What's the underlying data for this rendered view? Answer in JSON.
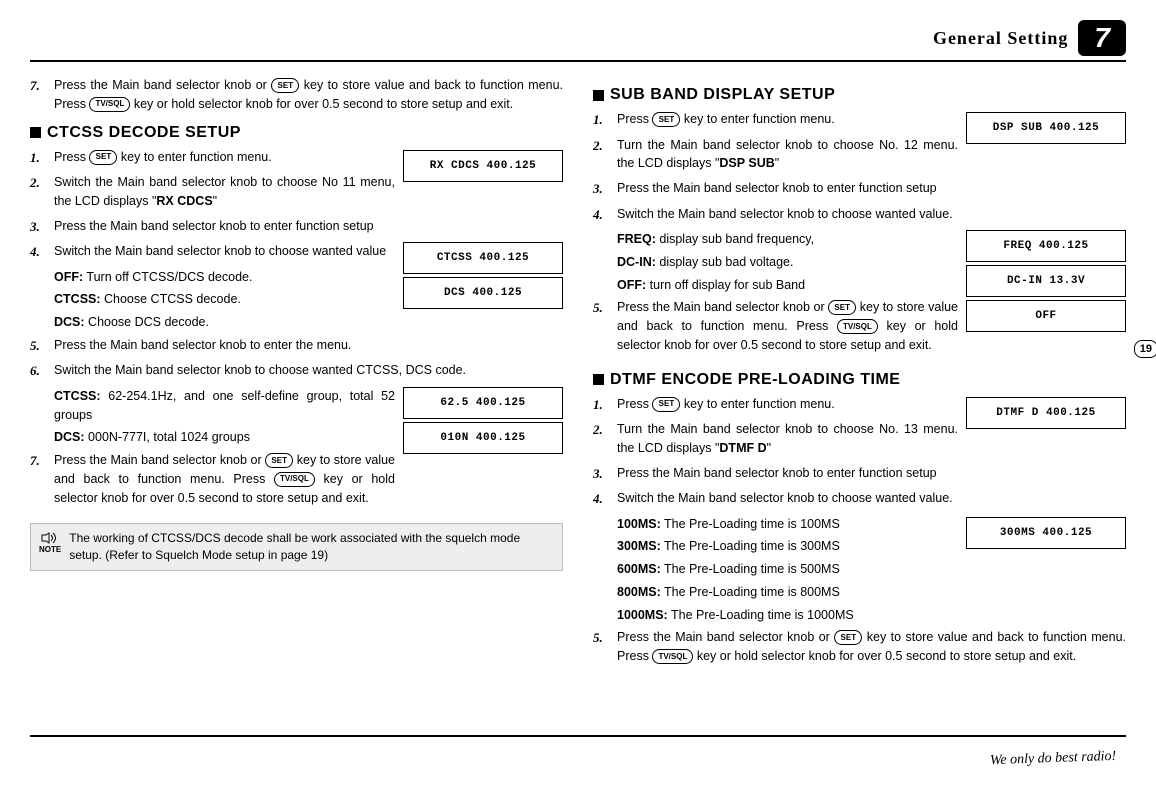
{
  "header": {
    "title": "General Setting",
    "chapter": "7"
  },
  "page_number": "19",
  "footer": "We only do best radio!",
  "keys": {
    "set": "SET",
    "tvsql": "TV/SQL"
  },
  "left": {
    "top_step": {
      "num": "7.",
      "text_a": "Press the Main band selector knob or ",
      "text_b": " key to store value and back to function menu.  Press ",
      "text_c": " key or hold selector knob for over 0.5 second to store setup and exit."
    },
    "ctcss": {
      "heading": "CTCSS DECODE SETUP",
      "lcd1": "RX CDCS 400.125",
      "lcd2": "CTCSS 400.125",
      "lcd3": "DCS 400.125",
      "lcd4": "62.5 400.125",
      "lcd5": "010N 400.125",
      "steps": {
        "s1_num": "1.",
        "s1_a": "Press ",
        "s1_b": " key to enter function menu.",
        "s2_num": "2.",
        "s2": "Switch the Main band selector knob to choose No 11 menu, the LCD displays \"",
        "s2_bold": "RX CDCS",
        "s2_c": "\"",
        "s3_num": "3.",
        "s3": "Press the Main band selector knob to enter function setup",
        "s4_num": "4.",
        "s4": "Switch the Main band selector knob to choose wanted value",
        "s4_sub1_b": "OFF:",
        "s4_sub1": " Turn off CTCSS/DCS decode.",
        "s4_sub2_b": "CTCSS:",
        "s4_sub2": " Choose CTCSS decode.",
        "s4_sub3_b": "DCS:",
        "s4_sub3": " Choose DCS decode.",
        "s5_num": "5.",
        "s5": "Press the Main band selector knob to enter the menu.",
        "s6_num": "6.",
        "s6": "Switch the Main band selector knob to choose wanted CTCSS, DCS code.",
        "s6_sub1_b": "CTCSS:",
        "s6_sub1": " 62-254.1Hz, and one self-define group, total 52 groups",
        "s6_sub2_b": "DCS:",
        "s6_sub2": " 000N-777I, total 1024 groups",
        "s7_num": "7.",
        "s7_a": "Press the Main band selector knob or ",
        "s7_b": "key to store value and back to function menu.  Press ",
        "s7_c": " key or hold selector knob for over 0.5 second to store setup and exit."
      },
      "note_label": "NOTE",
      "note": "The working of CTCSS/DCS decode shall be work associated with the squelch mode setup. (Refer to Squelch Mode setup in page 19)"
    }
  },
  "right": {
    "sub_band": {
      "heading": "SUB BAND DISPLAY SETUP",
      "lcd1": "DSP SUB 400.125",
      "lcd2": "FREQ 400.125",
      "lcd3": "DC-IN 13.3V",
      "lcd4": "OFF",
      "s1_num": "1.",
      "s1_a": "Press ",
      "s1_b": " key to enter function menu.",
      "s2_num": "2.",
      "s2": "Turn the Main band selector knob to choose No. 12 menu. the LCD displays \"",
      "s2_bold": "DSP SUB",
      "s2_c": "\"",
      "s3_num": "3.",
      "s3": "Press the Main band selector knob to enter function setup",
      "s4_num": "4.",
      "s4": "Switch the Main band selector knob to choose wanted value.",
      "s4_sub1_b": "FREQ:",
      "s4_sub1": " display sub band frequency,",
      "s4_sub2_b": "DC-IN:",
      "s4_sub2": " display sub bad voltage.",
      "s4_sub3_b": "OFF:",
      "s4_sub3": "  turn off display for sub Band",
      "s5_num": "5.",
      "s5_a": "Press the Main band selector knob or ",
      "s5_b": " key to store value and back to function menu. Press ",
      "s5_c": " key or hold selector knob for over 0.5 second to store setup and exit."
    },
    "dtmf": {
      "heading": "DTMF ENCODE PRE-LOADING TIME",
      "lcd1": "DTMF D 400.125",
      "lcd2": "300MS 400.125",
      "s1_num": "1.",
      "s1_a": "Press ",
      "s1_b": " key to enter function menu.",
      "s2_num": "2.",
      "s2": "Turn the Main band selector knob to choose No. 13 menu. the LCD displays \"",
      "s2_bold": "DTMF D",
      "s2_c": "\"",
      "s3_num": "3.",
      "s3": "Press the Main band selector knob to enter function setup",
      "s4_num": "4.",
      "s4": "Switch the Main band selector knob to choose wanted value.",
      "s4_sub1_b": "100MS:",
      "s4_sub1": " The Pre-Loading time is 100MS",
      "s4_sub2_b": "300MS:",
      "s4_sub2": " The Pre-Loading time is 300MS",
      "s4_sub3_b": "600MS:",
      "s4_sub3": " The Pre-Loading time is 500MS",
      "s4_sub4_b": "800MS:",
      "s4_sub4": " The Pre-Loading time is 800MS",
      "s4_sub5_b": "1000MS:",
      "s4_sub5": " The Pre-Loading time is 1000MS",
      "s5_num": "5.",
      "s5_a": "Press the Main band selector knob or ",
      "s5_b": " key to store value  and back to function menu.  Press ",
      "s5_c": " key or hold selector knob for over 0.5 second to store setup and exit."
    }
  }
}
